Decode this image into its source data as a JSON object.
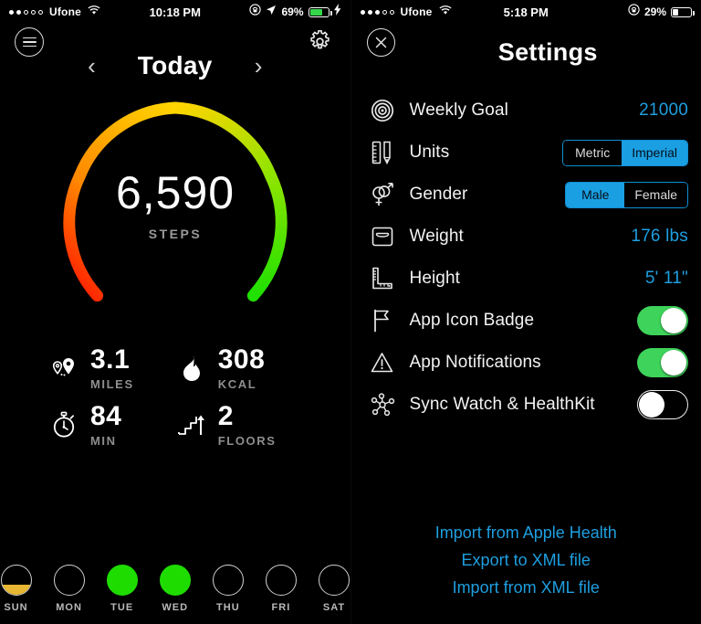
{
  "left": {
    "status": {
      "carrier": "Ufone",
      "signal_filled": 2,
      "signal_total": 5,
      "time": "10:18 PM",
      "battery_pct": "69%",
      "battery_level": 69,
      "battery_color": "#35d64a",
      "charging": true,
      "wifi_icon": "wifi-icon",
      "lock_icon": "rotation-lock-icon",
      "location_icon": "location-arrow-icon"
    },
    "header": {
      "menu_icon": "hamburger-menu-icon",
      "settings_icon": "gear-icon",
      "prev_icon": "chevron-left-icon",
      "next_icon": "chevron-right-icon",
      "title": "Today"
    },
    "gauge": {
      "steps_value": "6,590",
      "steps_label": "STEPS",
      "progress_pct": 100,
      "color_start": "#ff1200",
      "color_mid": "#ffd200",
      "color_end": "#1fe000"
    },
    "stats": [
      {
        "icon": "route-pins-icon",
        "value": "3.1",
        "unit": "MILES"
      },
      {
        "icon": "flame-icon",
        "value": "308",
        "unit": "KCAL"
      },
      {
        "icon": "stopwatch-icon",
        "value": "84",
        "unit": "MIN"
      },
      {
        "icon": "stairs-up-icon",
        "value": "2",
        "unit": "FLOORS"
      }
    ],
    "week": [
      {
        "label": "SUN",
        "fill_pct": 32,
        "color": "#e8b731"
      },
      {
        "label": "MON",
        "fill_pct": 0,
        "color": "#1fdc00"
      },
      {
        "label": "TUE",
        "fill_pct": 100,
        "color": "#1fdc00"
      },
      {
        "label": "WED",
        "fill_pct": 100,
        "color": "#1fdc00"
      },
      {
        "label": "THU",
        "fill_pct": 0,
        "color": "#1fdc00"
      },
      {
        "label": "FRI",
        "fill_pct": 0,
        "color": "#1fdc00"
      },
      {
        "label": "SAT",
        "fill_pct": 0,
        "color": "#1fdc00"
      }
    ]
  },
  "right": {
    "status": {
      "carrier": "Ufone",
      "signal_filled": 3,
      "signal_total": 5,
      "time": "5:18 PM",
      "battery_pct": "29%",
      "battery_level": 29,
      "battery_color": "#ffffff",
      "charging": false,
      "wifi_icon": "wifi-icon",
      "lock_icon": "rotation-lock-icon"
    },
    "header": {
      "close_icon": "close-circle-icon",
      "title": "Settings"
    },
    "rows": [
      {
        "icon": "target-icon",
        "label": "Weekly Goal",
        "type": "value",
        "value": "21000"
      },
      {
        "icon": "ruler-pencil-icon",
        "label": "Units",
        "type": "segment",
        "options": [
          "Metric",
          "Imperial"
        ],
        "selected": "Imperial"
      },
      {
        "icon": "gender-icon",
        "label": "Gender",
        "type": "segment",
        "options": [
          "Male",
          "Female"
        ],
        "selected": "Male"
      },
      {
        "icon": "scale-icon",
        "label": "Weight",
        "type": "value",
        "value": "176 lbs"
      },
      {
        "icon": "height-ruler-icon",
        "label": "Height",
        "type": "value",
        "value": "5' 11\""
      },
      {
        "icon": "flag-icon",
        "label": "App Icon Badge",
        "type": "toggle",
        "on": true
      },
      {
        "icon": "warning-triangle-icon",
        "label": "App Notifications",
        "type": "toggle",
        "on": true
      },
      {
        "icon": "network-nodes-icon",
        "label": "Sync Watch & HealthKit",
        "type": "toggle",
        "on": false
      }
    ],
    "links": [
      "Import from Apple Health",
      "Export to XML file",
      "Import from XML file"
    ],
    "accent_color": "#1e9fe0",
    "toggle_on_color": "#3ed35a"
  }
}
